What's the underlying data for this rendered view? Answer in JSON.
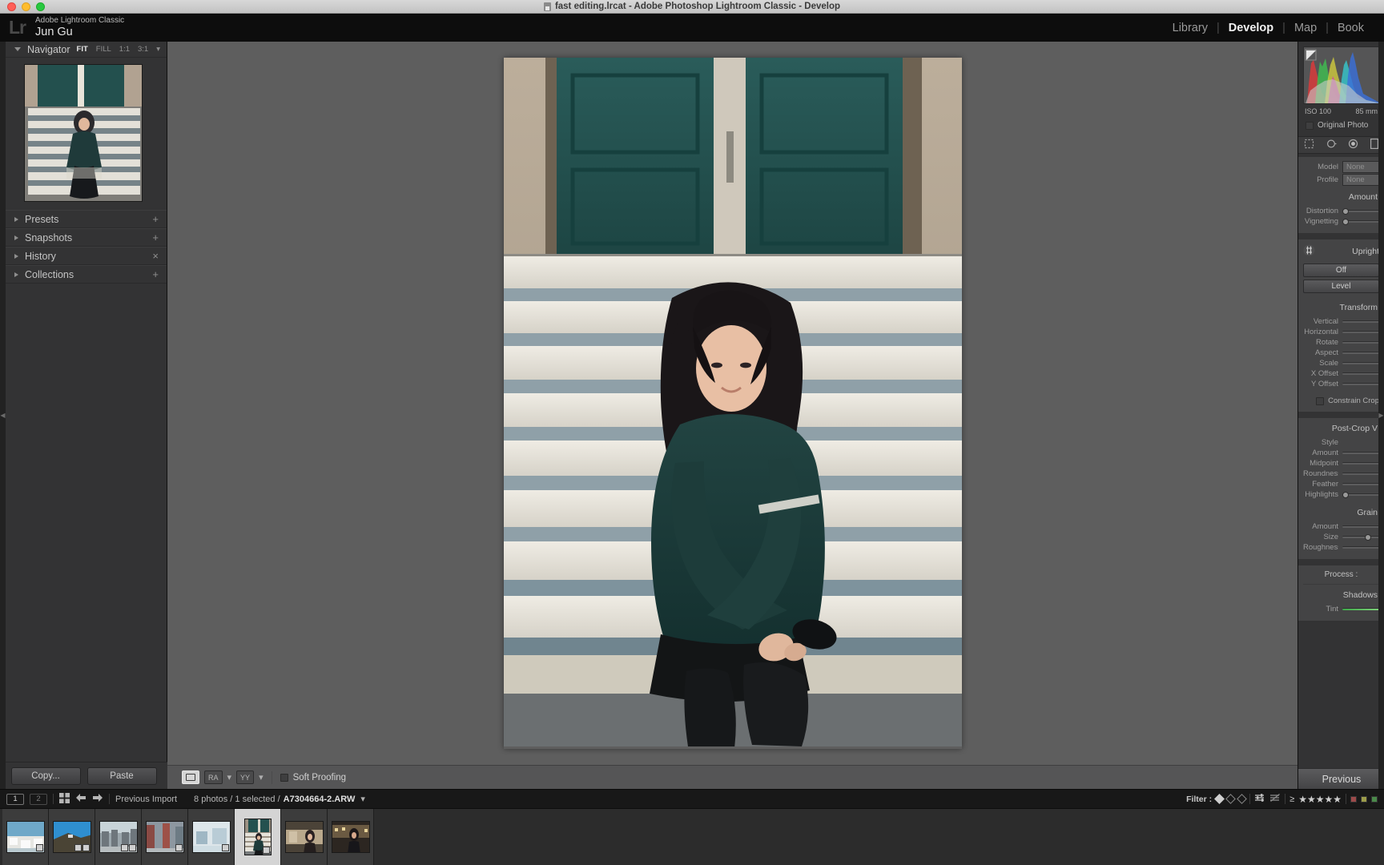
{
  "window": {
    "mac_title": "fast editing.lrcat - Adobe Photoshop Lightroom Classic - Develop",
    "doc_icon": "document-icon"
  },
  "header": {
    "logo": "Lr",
    "app_name": "Adobe Lightroom Classic",
    "user_name": "Jun Gu",
    "modules": [
      {
        "label": "Library",
        "active": false
      },
      {
        "label": "Develop",
        "active": true
      },
      {
        "label": "Map",
        "active": false
      },
      {
        "label": "Book",
        "active": false
      }
    ],
    "separator": "|"
  },
  "left_panel": {
    "navigator": {
      "title": "Navigator",
      "modes": [
        {
          "label": "FIT",
          "active": true
        },
        {
          "label": "FILL",
          "active": false
        },
        {
          "label": "1:1",
          "active": false
        },
        {
          "label": "3:1",
          "active": false
        }
      ],
      "more": "▾"
    },
    "sections": [
      {
        "label": "Presets",
        "action": "+",
        "action_name": "add-preset-icon"
      },
      {
        "label": "Snapshots",
        "action": "+",
        "action_name": "add-snapshot-icon"
      },
      {
        "label": "History",
        "action": "×",
        "action_name": "clear-history-icon"
      },
      {
        "label": "Collections",
        "action": "+",
        "action_name": "add-collection-icon"
      }
    ],
    "copy_label": "Copy...",
    "paste_label": "Paste"
  },
  "toolbar": {
    "view_loupe": "loupe-view-icon",
    "compare": "RA",
    "before_after": "YY",
    "soft_proofing_label": "Soft Proofing",
    "dropdown": "▾"
  },
  "right_panel": {
    "histogram": {
      "iso": "ISO 100",
      "focal": "85 mm",
      "original_photo_label": "Original Photo"
    },
    "tools": [
      "crop-tool-icon",
      "spot-removal-icon",
      "red-eye-icon",
      "graduated-filter-icon",
      "radial-filter-icon",
      "adjustment-brush-icon"
    ],
    "lens_corrections": {
      "model_label": "Model",
      "model_value": "None",
      "profile_label": "Profile",
      "profile_value": "None",
      "amount_label": "Amount",
      "distortion_label": "Distortion",
      "vignetting_label": "Vignetting"
    },
    "transform": {
      "upright_label": "Upright",
      "upright_icon": "upright-tool-icon",
      "off_label": "Off",
      "level_label": "Level",
      "transform_label": "Transform",
      "sliders": [
        "Vertical",
        "Horizontal",
        "Rotate",
        "Aspect",
        "Scale",
        "X Offset",
        "Y Offset"
      ],
      "constrain_label": "Constrain Crop"
    },
    "effects": {
      "post_crop_label": "Post-Crop V",
      "style_label": "Style",
      "sliders": [
        "Amount",
        "Midpoint",
        "Roundness",
        "Feather",
        "Highlights"
      ],
      "grain_label": "Grain",
      "grain_sliders": [
        "Amount",
        "Size",
        "Roughness"
      ]
    },
    "calibration": {
      "process_label": "Process :",
      "shadows_label": "Shadows",
      "tint_label": "Tint",
      "tint_color": "#3faa4a"
    },
    "previous_label": "Previous"
  },
  "filmstrip": {
    "screen_1": "1",
    "screen_2": "2",
    "grid_icon": "grid-view-icon",
    "back_icon": "back-arrow-icon",
    "forward_icon": "forward-arrow-icon",
    "source_label": "Previous Import",
    "photo_count": "8 photos / 1 selected / ",
    "selected_file": "A7304664-2.ARW",
    "dropdown": "▾",
    "filter_label": "Filter :",
    "stars": "★★★★★",
    "gte": "≥",
    "color_labels": [
      "#9c4a4a",
      "#9c9c4a",
      "#4a8a4a"
    ],
    "thumbnails": [
      {
        "name": "santorini-white-village",
        "orientation": "landscape",
        "selected": false,
        "badges": 1
      },
      {
        "name": "hillside-blue-sky",
        "orientation": "landscape",
        "selected": false,
        "badges": 2
      },
      {
        "name": "street-crowd",
        "orientation": "landscape",
        "selected": false,
        "badges": 2
      },
      {
        "name": "red-building-street",
        "orientation": "landscape",
        "selected": false,
        "badges": 1
      },
      {
        "name": "snowy-white-scene",
        "orientation": "landscape",
        "selected": false,
        "badges": 1
      },
      {
        "name": "woman-on-steps",
        "orientation": "portrait",
        "selected": true,
        "badges": 1
      },
      {
        "name": "woman-portrait-warm",
        "orientation": "landscape",
        "selected": false,
        "badges": 0
      },
      {
        "name": "woman-night-street",
        "orientation": "landscape",
        "selected": false,
        "badges": 0
      }
    ]
  },
  "photo": {
    "name": "woman-sitting-on-steps",
    "alt": "Woman in dark green sweater sitting on white stone steps in front of teal double doors"
  },
  "colors": {
    "panel_bg": "#333334",
    "canvas_bg": "#5e5e5e",
    "header_bg": "#0d0d0d",
    "filmstrip_bg": "#1a1a1a"
  }
}
